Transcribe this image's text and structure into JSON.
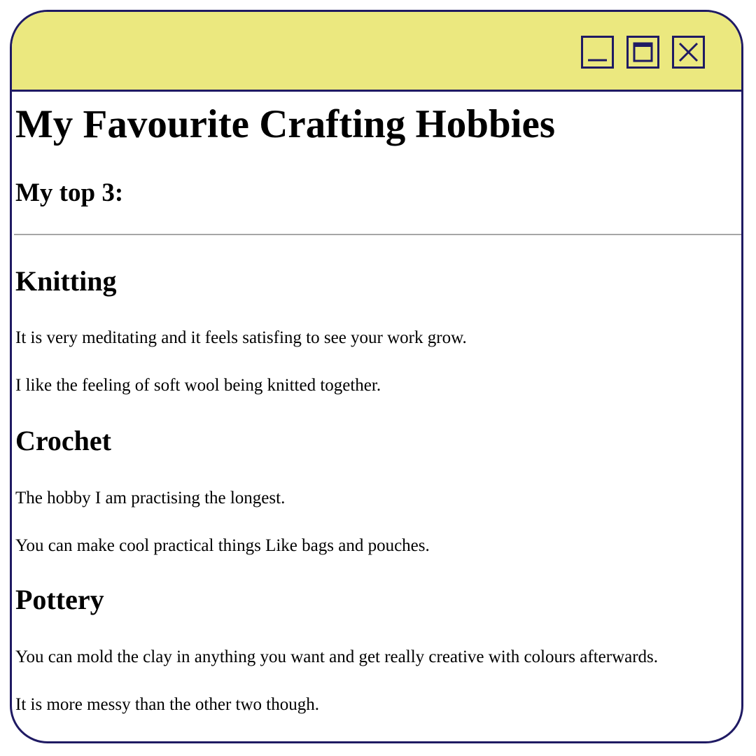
{
  "window": {
    "controls": {
      "minimize_icon": "minimize-icon",
      "maximize_icon": "maximize-icon",
      "close_icon": "close-icon"
    },
    "colors": {
      "titlebar": "#ebe87f",
      "border": "#1f1a63",
      "background": "#ffffff"
    }
  },
  "page": {
    "title": "My Favourite Crafting Hobbies",
    "subtitle": "My top 3:",
    "sections": [
      {
        "heading": "Knitting",
        "paragraphs": [
          "It is very meditating and it feels satisfing to see your work grow.",
          "I like the feeling of soft wool being knitted together."
        ]
      },
      {
        "heading": "Crochet",
        "paragraphs": [
          "The hobby I am practising the longest.",
          "You can make cool practical things Like bags and pouches."
        ]
      },
      {
        "heading": "Pottery",
        "paragraphs": [
          "You can mold the clay in anything you want and get really creative with colours afterwards.",
          "It is more messy than the other two though."
        ]
      }
    ]
  }
}
